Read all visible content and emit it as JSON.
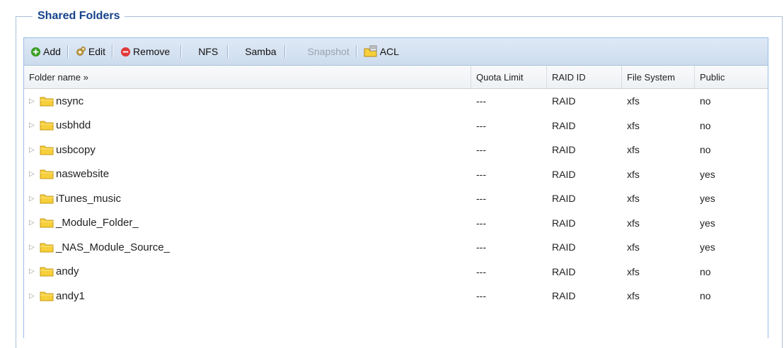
{
  "section": {
    "title": "Shared Folders"
  },
  "toolbar": {
    "add": "Add",
    "edit": "Edit",
    "remove": "Remove",
    "nfs": "NFS",
    "samba": "Samba",
    "snapshot": "Snapshot",
    "acl": "ACL"
  },
  "columns": {
    "folder_name": "Folder name »",
    "quota_limit": "Quota Limit",
    "raid_id": "RAID ID",
    "file_system": "File System",
    "public": "Public"
  },
  "rows": [
    {
      "name": "nsync",
      "quota": "---",
      "raid": "RAID",
      "fs": "xfs",
      "public": "no"
    },
    {
      "name": "usbhdd",
      "quota": "---",
      "raid": "RAID",
      "fs": "xfs",
      "public": "no"
    },
    {
      "name": "usbcopy",
      "quota": "---",
      "raid": "RAID",
      "fs": "xfs",
      "public": "no"
    },
    {
      "name": "naswebsite",
      "quota": "---",
      "raid": "RAID",
      "fs": "xfs",
      "public": "yes"
    },
    {
      "name": "iTunes_music",
      "quota": "---",
      "raid": "RAID",
      "fs": "xfs",
      "public": "yes"
    },
    {
      "name": "_Module_Folder_",
      "quota": "---",
      "raid": "RAID",
      "fs": "xfs",
      "public": "yes"
    },
    {
      "name": "_NAS_Module_Source_",
      "quota": "---",
      "raid": "RAID",
      "fs": "xfs",
      "public": "yes"
    },
    {
      "name": "andy",
      "quota": "---",
      "raid": "RAID",
      "fs": "xfs",
      "public": "no"
    },
    {
      "name": "andy1",
      "quota": "---",
      "raid": "RAID",
      "fs": "xfs",
      "public": "no"
    }
  ],
  "icons": {
    "add": "add-icon",
    "edit": "gear-edit-icon",
    "remove": "remove-icon",
    "acl": "acl-folder-icon",
    "folder": "folder-icon",
    "expand": "expand-arrow-icon"
  },
  "colors": {
    "title": "#15428b",
    "toolbar_bg": "#dfe9f5",
    "folder_fill": "#f7cf3a",
    "add_green": "#3a9d23",
    "remove_red": "#e03a3a"
  }
}
